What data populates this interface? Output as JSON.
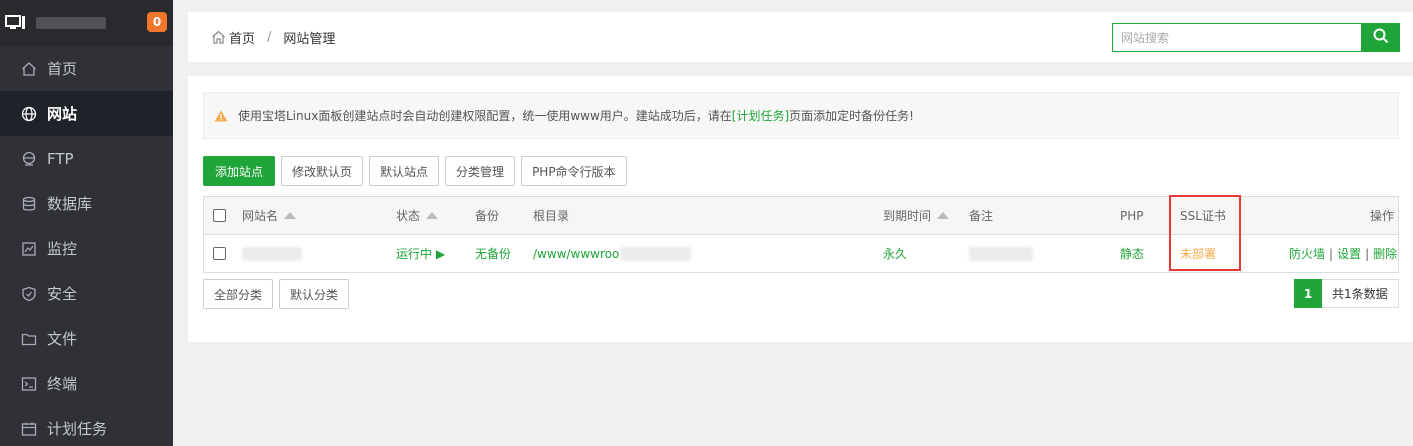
{
  "sidebar": {
    "badge": "0",
    "items": [
      {
        "label": "首页",
        "icon": "home-icon"
      },
      {
        "label": "网站",
        "icon": "globe-icon",
        "active": true
      },
      {
        "label": "FTP",
        "icon": "ftp-icon"
      },
      {
        "label": "数据库",
        "icon": "database-icon"
      },
      {
        "label": "监控",
        "icon": "monitor-chart-icon"
      },
      {
        "label": "安全",
        "icon": "shield-icon"
      },
      {
        "label": "文件",
        "icon": "folder-icon"
      },
      {
        "label": "终端",
        "icon": "terminal-icon"
      },
      {
        "label": "计划任务",
        "icon": "calendar-icon"
      }
    ]
  },
  "header": {
    "breadcrumb_home": "首页",
    "breadcrumb_sep": "/",
    "breadcrumb_current": "网站管理",
    "search_placeholder": "网站搜索"
  },
  "notice": {
    "text_before": "使用宝塔Linux面板创建站点时会自动创建权限配置，统一使用www用户。建站成功后，请在",
    "link": "[计划任务]",
    "text_after": "页面添加定时备份任务!"
  },
  "toolbar": {
    "add_site": "添加站点",
    "modify_default_page": "修改默认页",
    "default_site": "默认站点",
    "category_manage": "分类管理",
    "php_cli_version": "PHP命令行版本"
  },
  "table": {
    "headers": {
      "name": "网站名",
      "status": "状态",
      "backup": "备份",
      "root": "根目录",
      "expire": "到期时间",
      "remark": "备注",
      "php": "PHP",
      "ssl": "SSL证书",
      "ops": "操作"
    },
    "rows": [
      {
        "status": "运行中 ▶",
        "backup": "无备份",
        "root": "/www/wwwroo",
        "expire": "永久",
        "php": "静态",
        "ssl": "未部署",
        "op_firewall": "防火墙",
        "op_settings": "设置",
        "op_delete": "删除",
        "op_sep": "|"
      }
    ]
  },
  "bottom": {
    "all_categories": "全部分类",
    "default_category": "默认分类",
    "current_page": "1",
    "total": "共1条数据"
  },
  "colors": {
    "accent": "#20a53a",
    "highlight": "#e53935",
    "badge": "#f0762b"
  }
}
